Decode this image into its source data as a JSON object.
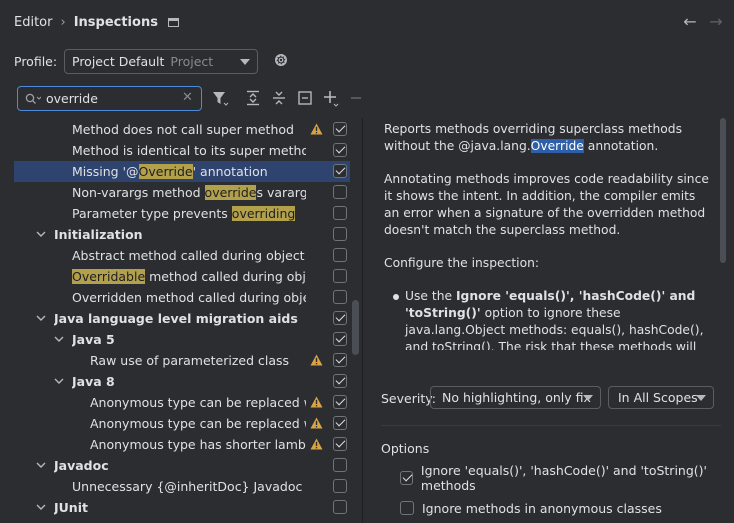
{
  "breadcrumb": {
    "parent": "Editor",
    "current": "Inspections"
  },
  "profile": {
    "label": "Profile:",
    "value": "Project Default",
    "scope": "Project"
  },
  "search": {
    "value": "override"
  },
  "tree": [
    {
      "text": "Method does not call super method",
      "level": 2,
      "warn": true,
      "checked": true
    },
    {
      "text": "Method is identical to its super method",
      "level": 2,
      "checked": true
    },
    {
      "pre": "Missing '@",
      "hl": "Override",
      "post": "' annotation",
      "level": 2,
      "checked": true,
      "selected": true
    },
    {
      "pre": "Non-varargs method ",
      "hl": "override",
      "post": "s varargs meth",
      "level": 2,
      "checked": false
    },
    {
      "pre": "Parameter type prevents ",
      "hl": "overriding",
      "post": "",
      "level": 2,
      "checked": false
    },
    {
      "text": "Initialization",
      "level": 1,
      "group": true,
      "expanded": true,
      "checked": false
    },
    {
      "text": "Abstract method called during object const",
      "level": 2,
      "checked": false
    },
    {
      "pre": "",
      "hl": "Overridable",
      "post": " method called during object co",
      "level": 2,
      "checked": false
    },
    {
      "text": "Overridden method called during object co",
      "level": 2,
      "checked": false
    },
    {
      "text": "Java language level migration aids",
      "level": 1,
      "group": true,
      "expanded": true,
      "checked": true
    },
    {
      "text": "Java 5",
      "level": 2,
      "group": true,
      "expanded": true,
      "checked": true
    },
    {
      "text": "Raw use of parameterized class",
      "level": 3,
      "warn": true,
      "checked": true
    },
    {
      "text": "Java 8",
      "level": 2,
      "group": true,
      "expanded": true,
      "checked": true
    },
    {
      "text": "Anonymous type can be replaced with l",
      "level": 3,
      "warn": true,
      "checked": true
    },
    {
      "text": "Anonymous type can be replaced with r",
      "level": 3,
      "warn": true,
      "checked": true
    },
    {
      "text": "Anonymous type has shorter lambda alt",
      "level": 3,
      "warn": true,
      "checked": true
    },
    {
      "text": "Javadoc",
      "level": 1,
      "group": true,
      "expanded": true,
      "checked": false
    },
    {
      "text": "Unnecessary {@inheritDoc} Javadoc comme",
      "level": 2,
      "checked": false
    },
    {
      "text": "JUnit",
      "level": 1,
      "group": true,
      "expanded": true,
      "checked": false
    }
  ],
  "description": {
    "p1_pre": "Reports methods overriding superclass methods without the @java.lang.",
    "p1_hl": "Override",
    "p1_post": " annotation.",
    "p2": "Annotating methods improves code readability since it shows the intent. In addition, the compiler emits an error when a signature of the overridden method doesn't match the superclass method.",
    "p3": "Configure the inspection:",
    "b1_pre": "Use the ",
    "b1_bold": "Ignore 'equals()', 'hashCode()' and 'toString()'",
    "b1_post": " option to ignore these java.lang.Object methods: equals(), hashCode(), and toString(). The risk that these methods will disappear and your code won't"
  },
  "severity": {
    "label": "Severity:",
    "value": "No highlighting, only fix",
    "scope": "In All Scopes"
  },
  "options": {
    "title": "Options",
    "items": [
      {
        "label": "Ignore 'equals()', 'hashCode()' and 'toString()' methods",
        "checked": true
      },
      {
        "label": "Ignore methods in anonymous classes",
        "checked": false
      }
    ]
  },
  "colors": {
    "accent": "#4e8ad7",
    "highlight": "#b3a04b",
    "selection": "#2e436e",
    "warning": "#d9a343"
  }
}
